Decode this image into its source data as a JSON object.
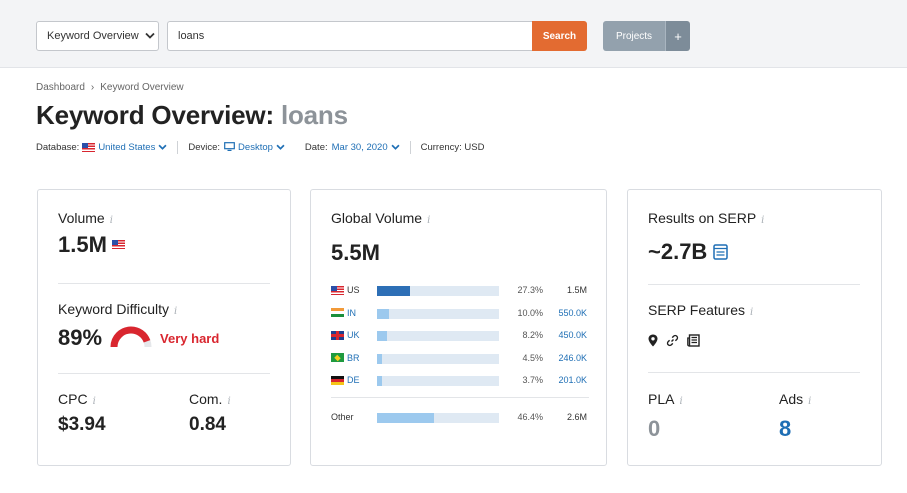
{
  "toolbar": {
    "dropdown_label": "Keyword Overview",
    "search_value": "loans",
    "search_button": "Search",
    "projects_button": "Projects",
    "plus_button": "+"
  },
  "breadcrumb": {
    "home": "Dashboard",
    "separator": "›",
    "current": "Keyword Overview"
  },
  "page": {
    "title_prefix": "Keyword Overview:",
    "keyword": "loans"
  },
  "meta": {
    "database_label": "Database:",
    "database_value": "United States",
    "device_label": "Device:",
    "device_value": "Desktop",
    "date_label": "Date:",
    "date_value": "Mar 30, 2020",
    "currency": "Currency: USD"
  },
  "volume": {
    "label": "Volume",
    "value": "1.5M"
  },
  "difficulty": {
    "label": "Keyword Difficulty",
    "value": "89%",
    "level_text": "Very hard",
    "gauge_fraction": 0.89
  },
  "cpc": {
    "label": "CPC",
    "value": "$3.94"
  },
  "competition": {
    "label": "Com.",
    "value": "0.84"
  },
  "global_volume": {
    "label": "Global Volume",
    "value": "5.5M",
    "rows": [
      {
        "country": "US",
        "percent": "27.3%",
        "volume": "1.5M",
        "fraction": 0.273,
        "linked": false,
        "flag": "flag-us"
      },
      {
        "country": "IN",
        "percent": "10.0%",
        "volume": "550.0K",
        "fraction": 0.1,
        "linked": true,
        "flag": "flag-in"
      },
      {
        "country": "UK",
        "percent": "8.2%",
        "volume": "450.0K",
        "fraction": 0.082,
        "linked": true,
        "flag": "flag-uk"
      },
      {
        "country": "BR",
        "percent": "4.5%",
        "volume": "246.0K",
        "fraction": 0.045,
        "linked": true,
        "flag": "flag-br"
      },
      {
        "country": "DE",
        "percent": "3.7%",
        "volume": "201.0K",
        "fraction": 0.037,
        "linked": true,
        "flag": "flag-de"
      }
    ],
    "other": {
      "label": "Other",
      "percent": "46.4%",
      "volume": "2.6M",
      "fraction": 0.464
    }
  },
  "serp": {
    "results_label": "Results on SERP",
    "results_value": "~2.7B",
    "features_label": "SERP Features",
    "feature_icons": [
      "map-pin-icon",
      "link-icon",
      "news-icon"
    ]
  },
  "pla": {
    "label": "PLA",
    "value": "0"
  },
  "ads": {
    "label": "Ads",
    "value": "8"
  },
  "colors": {
    "search_button": "#e36b31",
    "projects_button": "#93a1ad",
    "link": "#1f6fb5",
    "very_hard": "#d9262f",
    "bar_primary": "#2d6fb6",
    "bar_secondary": "#9cc9ee",
    "bar_track": "#dfe9f3"
  }
}
